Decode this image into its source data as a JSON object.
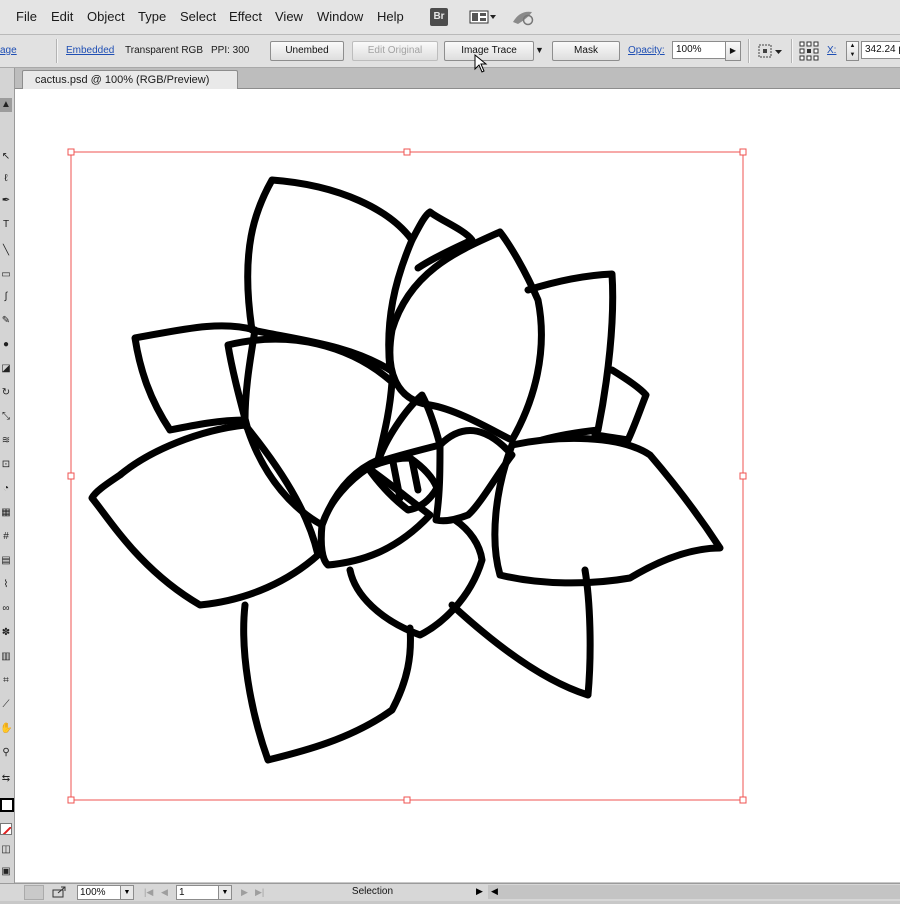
{
  "menubar": {
    "items": [
      "File",
      "Edit",
      "Object",
      "Type",
      "Select",
      "Effect",
      "View",
      "Window",
      "Help"
    ],
    "bridge_label": "Br"
  },
  "controlbar": {
    "image_link_label": "age",
    "embedded_label": "Embedded",
    "color_mode": "Transparent RGB",
    "ppi": "PPI: 300",
    "unembed_label": "Unembed",
    "edit_original_label": "Edit Original",
    "image_trace_label": "Image Trace",
    "mask_label": "Mask",
    "opacity_label": "Opacity:",
    "opacity_value": "100%",
    "x_label": "X:",
    "x_value": "342.24 p"
  },
  "document": {
    "tab_title": "cactus.psd @ 100% (RGB/Preview)"
  },
  "statusbar": {
    "zoom": "100%",
    "artboard": "1",
    "status": "Selection"
  },
  "colors": {
    "selection": "#ef5350",
    "artwork": "#000000",
    "menubar_bg": "#e4e4e4",
    "link": "#1f4fb4"
  }
}
